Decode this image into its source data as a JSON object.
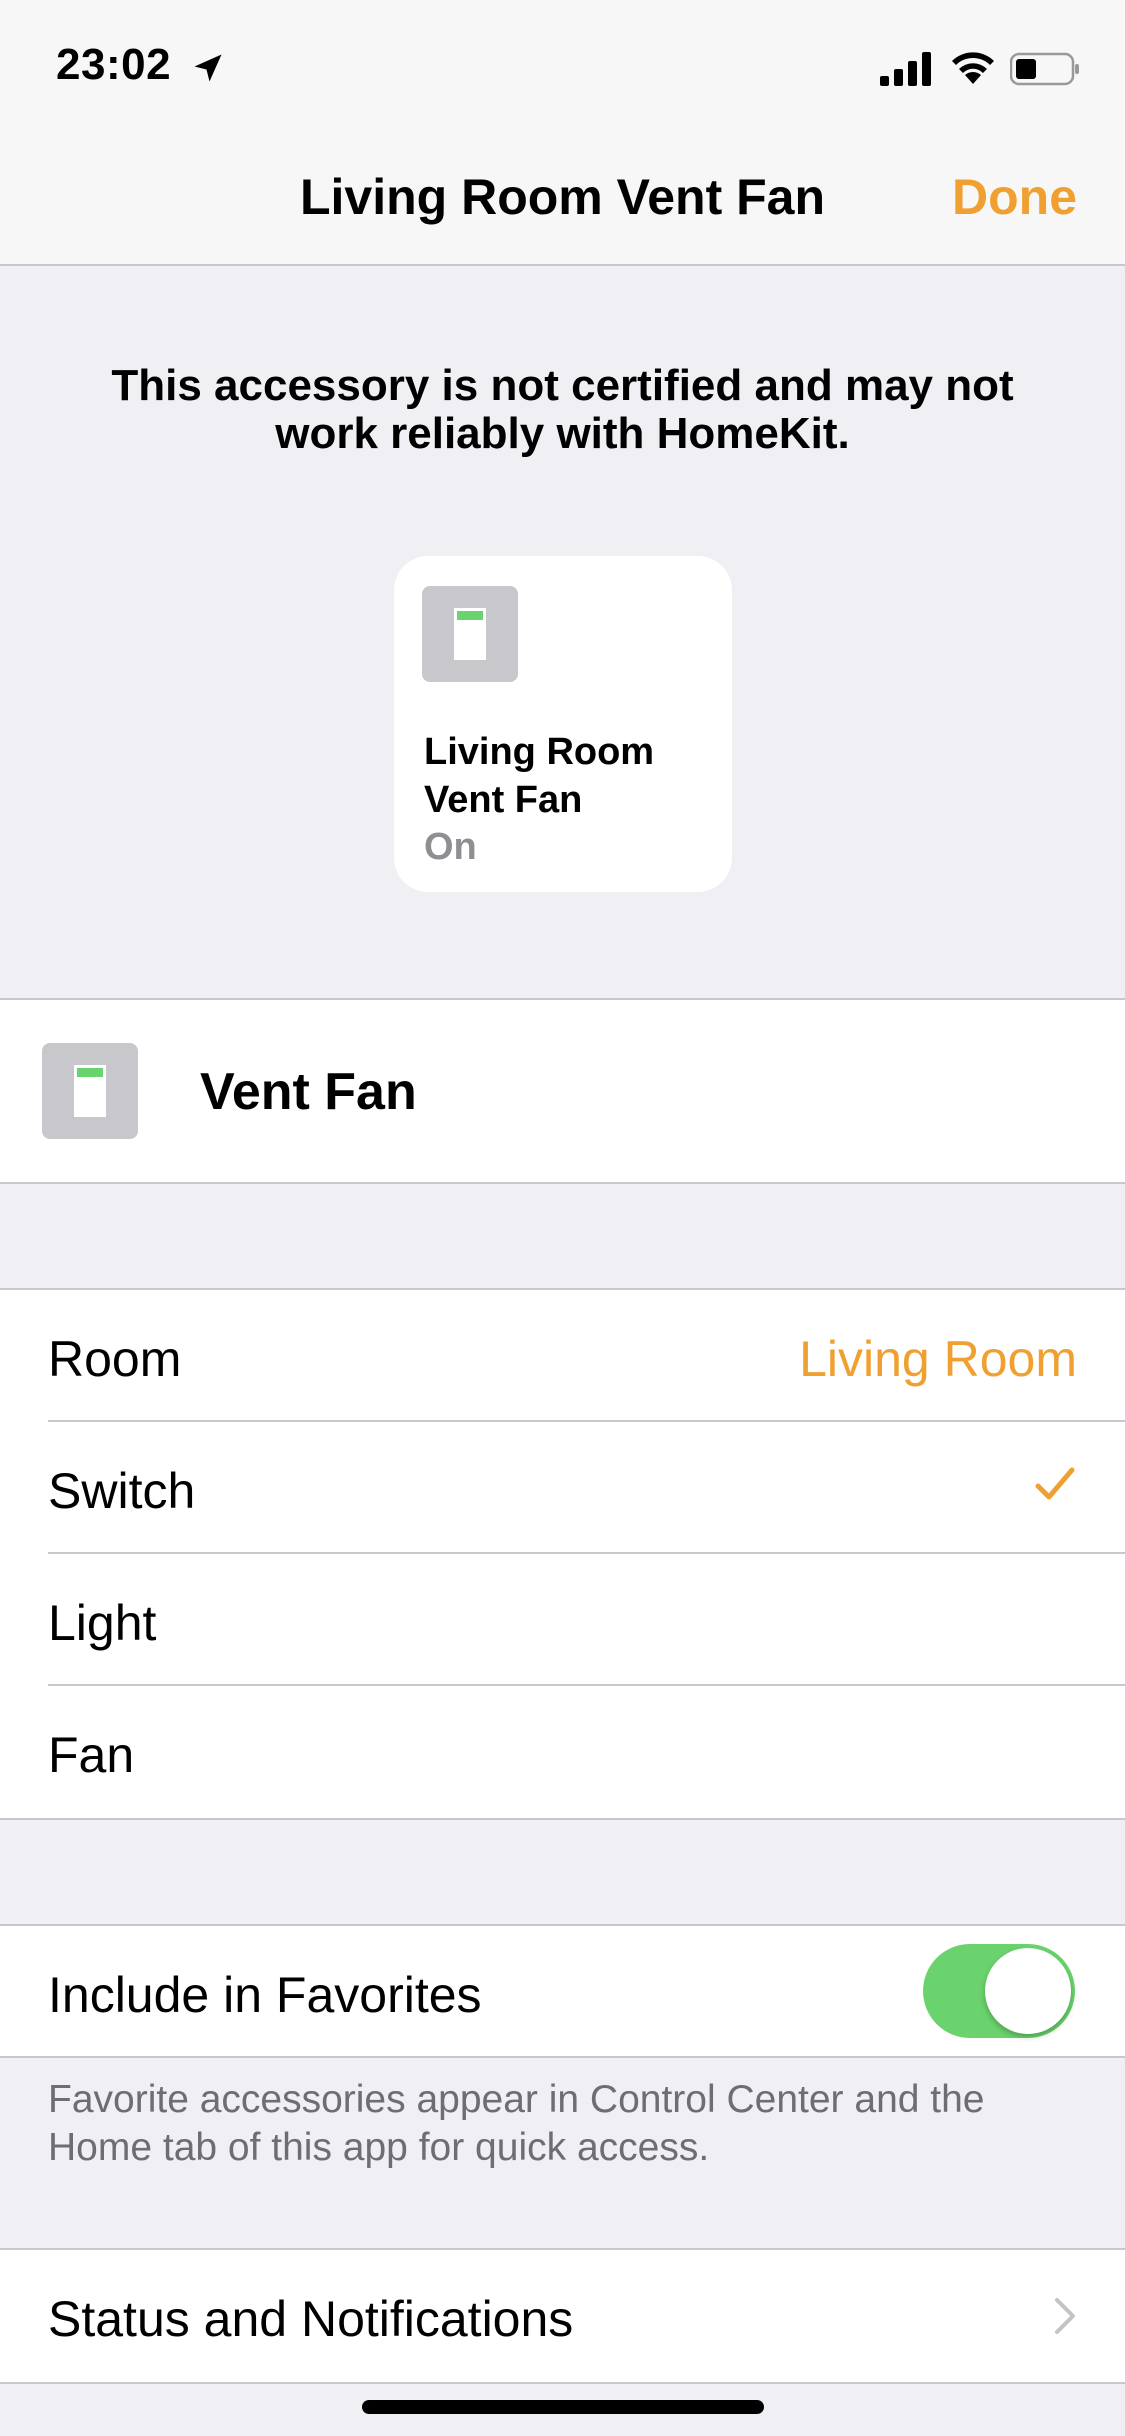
{
  "status_bar": {
    "time": "23:02",
    "icons": [
      "location-arrow-icon",
      "cellular-signal-icon",
      "wifi-icon",
      "battery-icon"
    ]
  },
  "nav": {
    "title": "Living Room Vent Fan",
    "done_label": "Done"
  },
  "warning": "This accessory is not certified and may not work reliably with HomeKit.",
  "tile": {
    "name": "Living Room Vent Fan",
    "status": "On",
    "icon": "switch-icon"
  },
  "accessory": {
    "name": "Vent Fan",
    "icon": "switch-icon"
  },
  "settings": {
    "room_label": "Room",
    "room_value": "Living Room",
    "types": [
      {
        "label": "Switch",
        "selected": true
      },
      {
        "label": "Light",
        "selected": false
      },
      {
        "label": "Fan",
        "selected": false
      }
    ]
  },
  "favorites": {
    "label": "Include in Favorites",
    "enabled": true,
    "footnote": "Favorite accessories appear in Control Center and the Home tab of this app for quick access."
  },
  "notifications": {
    "label": "Status and Notifications"
  },
  "colors": {
    "accent": "#f0a030",
    "toggle_on": "#6ad36d",
    "background": "#efeff4"
  }
}
